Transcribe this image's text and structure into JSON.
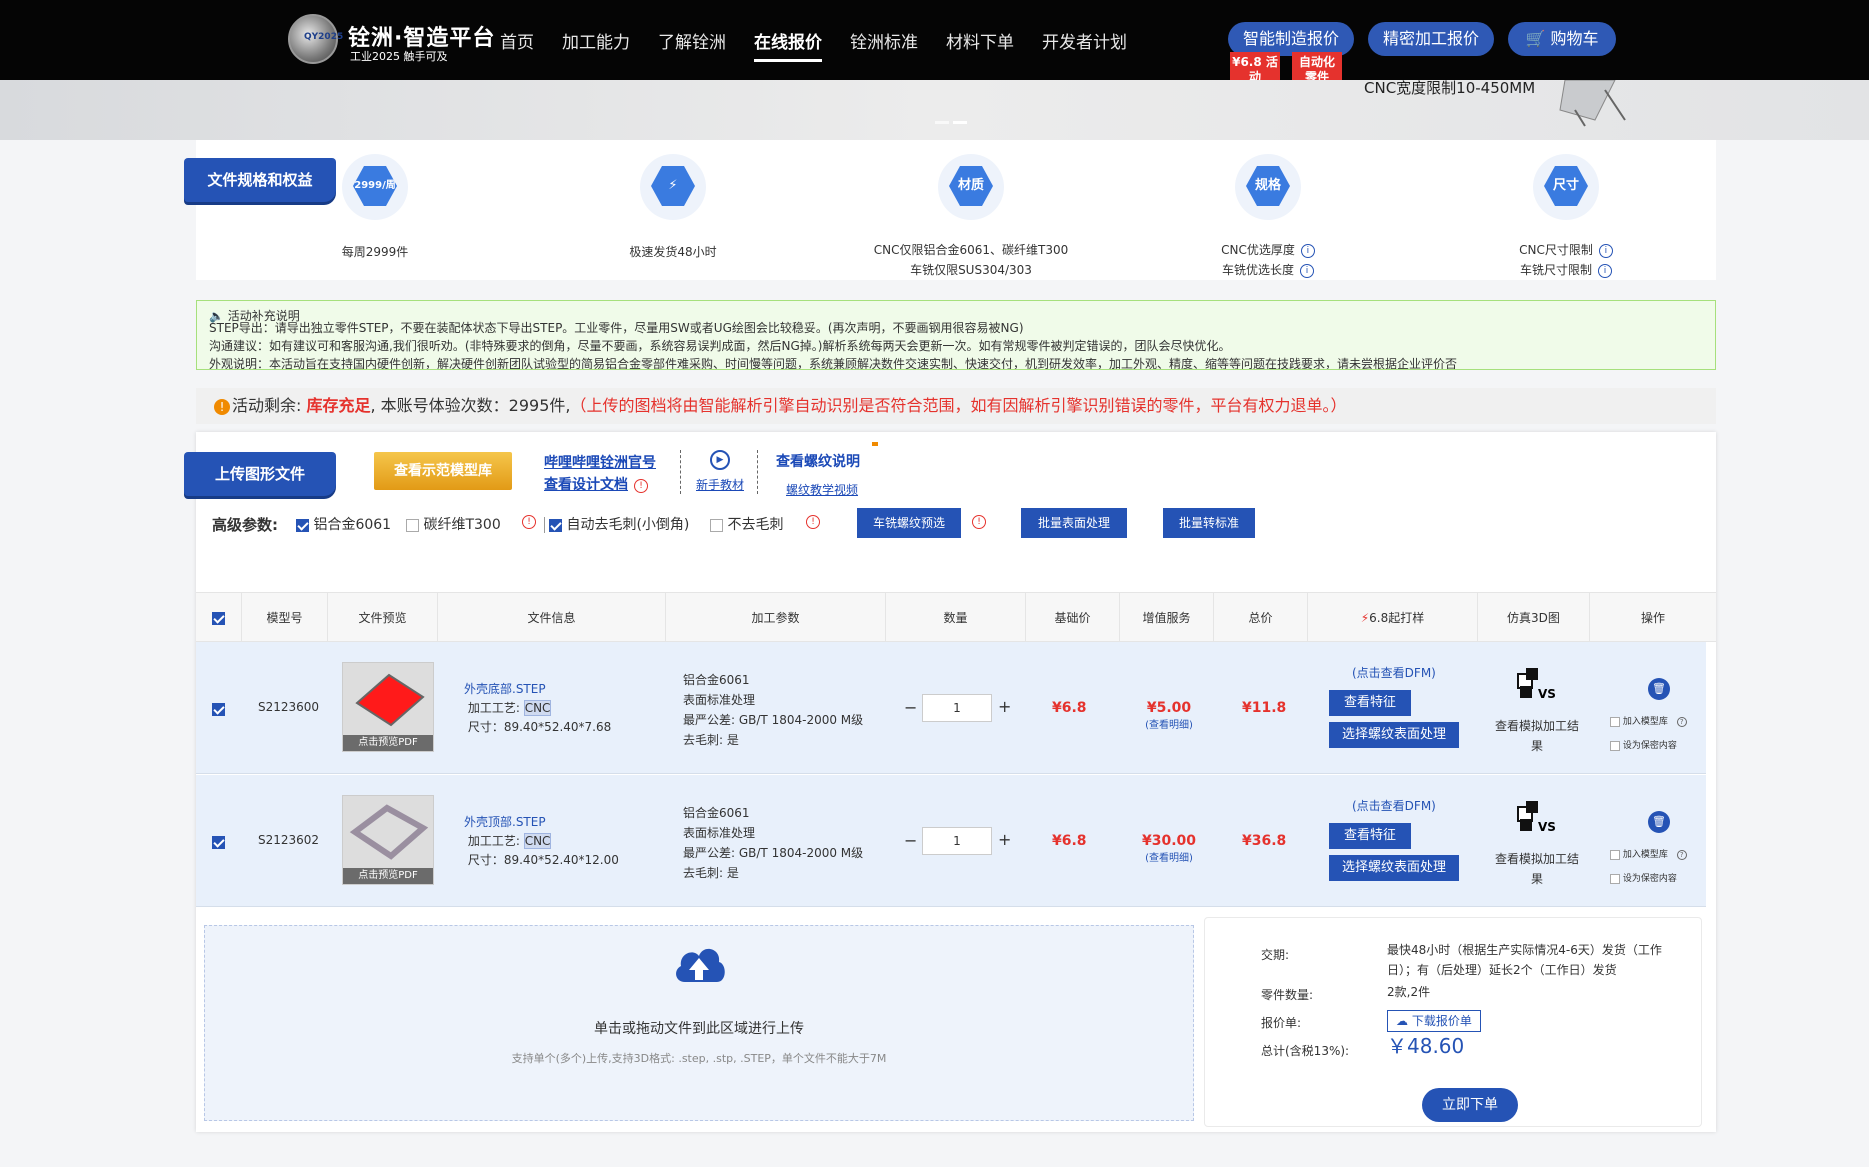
{
  "header": {
    "brand_title": "铨洲·智造平台",
    "brand_sub": "工业2025 触手可及",
    "logo_text": "QY2025",
    "nav": [
      "首页",
      "加工能力",
      "了解铨洲",
      "在线报价",
      "铨洲标准",
      "材料下单",
      "开发者计划"
    ],
    "active_nav": "在线报价",
    "btn_smart": "智能制造报价",
    "btn_precise": "精密加工报价",
    "btn_cart": "购物车",
    "badge1": "¥6.8 活动",
    "badge2": "自动化 零件"
  },
  "banner": {
    "text": "CNC宽度限制10-450MM"
  },
  "features": {
    "ribbon": "文件规格和权益",
    "items": [
      {
        "icon": "2999/周",
        "label": "每周2999件"
      },
      {
        "icon": "⚡",
        "label": "极速发货48小时"
      },
      {
        "icon": "材质",
        "label": "CNC仅限铝合金6061、碳纤维T300",
        "label2": "车铣仅限SUS304/303"
      },
      {
        "icon": "规格",
        "label": "CNC优选厚度",
        "label2": "车铣优选长度"
      },
      {
        "icon": "尺寸",
        "label": "CNC尺寸限制",
        "label2": "车铣尺寸限制"
      }
    ]
  },
  "notice": {
    "title": "活动补充说明",
    "line1": "STEP导出：请导出独立零件STEP，不要在装配体状态下导出STEP。工业零件，尽量用SW或者UG绘图会比较稳妥。(再次声明，不要画钢用很容易被NG)",
    "line2": "沟通建议：如有建议可和客服沟通,我们很听劝。(非特殊要求的倒角，尽量不要画，系统容易误判成面，然后NG掉。)解析系统每两天会更新一次。如有常规零件被判定错误的，团队会尽快优化。",
    "line3": "外观说明：本活动旨在支持国内硬件创新，解决硬件创新团队试验型的简易铝合金零部件难采购、时间慢等问题，系统兼顾解决数件交速实制、快速交付，机到研发效率，加工外观、精度、缩等等问题在技践要求，请未尝根据企业评价否"
  },
  "remain": {
    "prefix": "活动剩余: ",
    "stock": "库存充足",
    "mid": ", 本账号体验次数：2995件,",
    "warn": "（上传的图档将由智能解析引擎自动识别是否符合范围，如有因解析引擎识别错误的零件，平台有权力退单。）"
  },
  "upload_section": {
    "ribbon": "上传图形文件",
    "demo_btn": "查看示范模型库",
    "link_bili": "哔哩哔哩铨洲官号",
    "link_doc": "查看设计文档",
    "newbie": "新手教材",
    "thread_title": "查看螺纹说明",
    "thread_video": "螺纹教学视频"
  },
  "params": {
    "label": "高级参数:",
    "opt1": "铝合金6061",
    "opt2": "碳纤维T300",
    "opt3": "自动去毛刺(小倒角)",
    "opt4": "不去毛刺",
    "btn1": "车铣螺纹预选",
    "btn2": "批量表面处理",
    "btn3": "批量转标准"
  },
  "table": {
    "headers": [
      "模型号",
      "文件预览",
      "文件信息",
      "加工参数",
      "数量",
      "基础价",
      "增值服务",
      "总价",
      "6.8起打样",
      "仿真3D图",
      "操作"
    ],
    "rows": [
      {
        "id": "S2123600",
        "preview_cap": "点击预览PDF",
        "file": "外壳底部.STEP",
        "proc_label": "加工工艺:",
        "proc": "CNC",
        "size": "尺寸：89.40*52.40*7.68",
        "p1": "铝合金6061",
        "p2": "表面标准处理",
        "p3": "最严公差: GB/T 1804-2000 M级",
        "p4": "去毛刺: 是",
        "qty": "1",
        "base": "¥6.8",
        "service": "¥5.00",
        "service_detail": "(查看明细)",
        "total": "¥11.8",
        "dfm": "(点击查看DFM)",
        "btn_feature": "查看特征",
        "btn_thread": "选择螺纹表面处理",
        "sim": "查看模拟加工结果",
        "op1": "加入模型库",
        "op2": "设为保密内容"
      },
      {
        "id": "S2123602",
        "preview_cap": "点击预览PDF",
        "file": "外壳顶部.STEP",
        "proc_label": "加工工艺:",
        "proc": "CNC",
        "size": "尺寸：89.40*52.40*12.00",
        "p1": "铝合金6061",
        "p2": "表面标准处理",
        "p3": "最严公差: GB/T 1804-2000 M级",
        "p4": "去毛刺: 是",
        "qty": "1",
        "base": "¥6.8",
        "service": "¥30.00",
        "service_detail": "(查看明细)",
        "total": "¥36.8",
        "dfm": "(点击查看DFM)",
        "btn_feature": "查看特征",
        "btn_thread": "选择螺纹表面处理",
        "sim": "查看模拟加工结果",
        "op1": "加入模型库",
        "op2": "设为保密内容"
      }
    ]
  },
  "dropzone": {
    "title": "单击或拖动文件到此区域进行上传",
    "hint": "支持单个(多个)上传,支持3D格式: .step, .stp, .STEP，单个文件不能大于7M"
  },
  "summary": {
    "delivery_label": "交期:",
    "delivery": "最快48小时（根据生产实际情况4-6天）发货（工作日）；有（后处理）延长2个（工作日）发货",
    "count_label": "零件数量:",
    "count": "2款,2件",
    "quote_label": "报价单:",
    "quote_btn": "下载报价单",
    "total_label": "总计(含税13%):",
    "total": "￥48.60",
    "order_btn": "立即下单"
  }
}
